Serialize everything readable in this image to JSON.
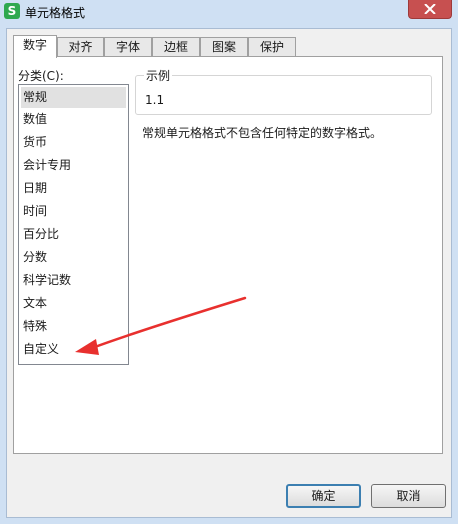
{
  "window": {
    "title": "单元格格式",
    "app_icon_letter": "S"
  },
  "tabs": [
    {
      "label": "数字",
      "active": true
    },
    {
      "label": "对齐"
    },
    {
      "label": "字体"
    },
    {
      "label": "边框"
    },
    {
      "label": "图案"
    },
    {
      "label": "保护"
    }
  ],
  "category": {
    "label": "分类(C):",
    "items": [
      "常规",
      "数值",
      "货币",
      "会计专用",
      "日期",
      "时间",
      "百分比",
      "分数",
      "科学记数",
      "文本",
      "特殊",
      "自定义"
    ],
    "selected": "常规"
  },
  "sample": {
    "legend": "示例",
    "value": "1.1"
  },
  "description": "常规单元格格式不包含任何特定的数字格式。",
  "buttons": {
    "ok": "确定",
    "cancel": "取消"
  },
  "annotation": {
    "arrow_color": "#e8302e",
    "points_to": "自定义"
  },
  "colors": {
    "window_frame": "#cfe0f3",
    "dialog_bg": "#f0f0f0",
    "close_button": "#c75050",
    "selected_item": "#e1e1e1",
    "default_button_border": "#3c7fb1"
  }
}
